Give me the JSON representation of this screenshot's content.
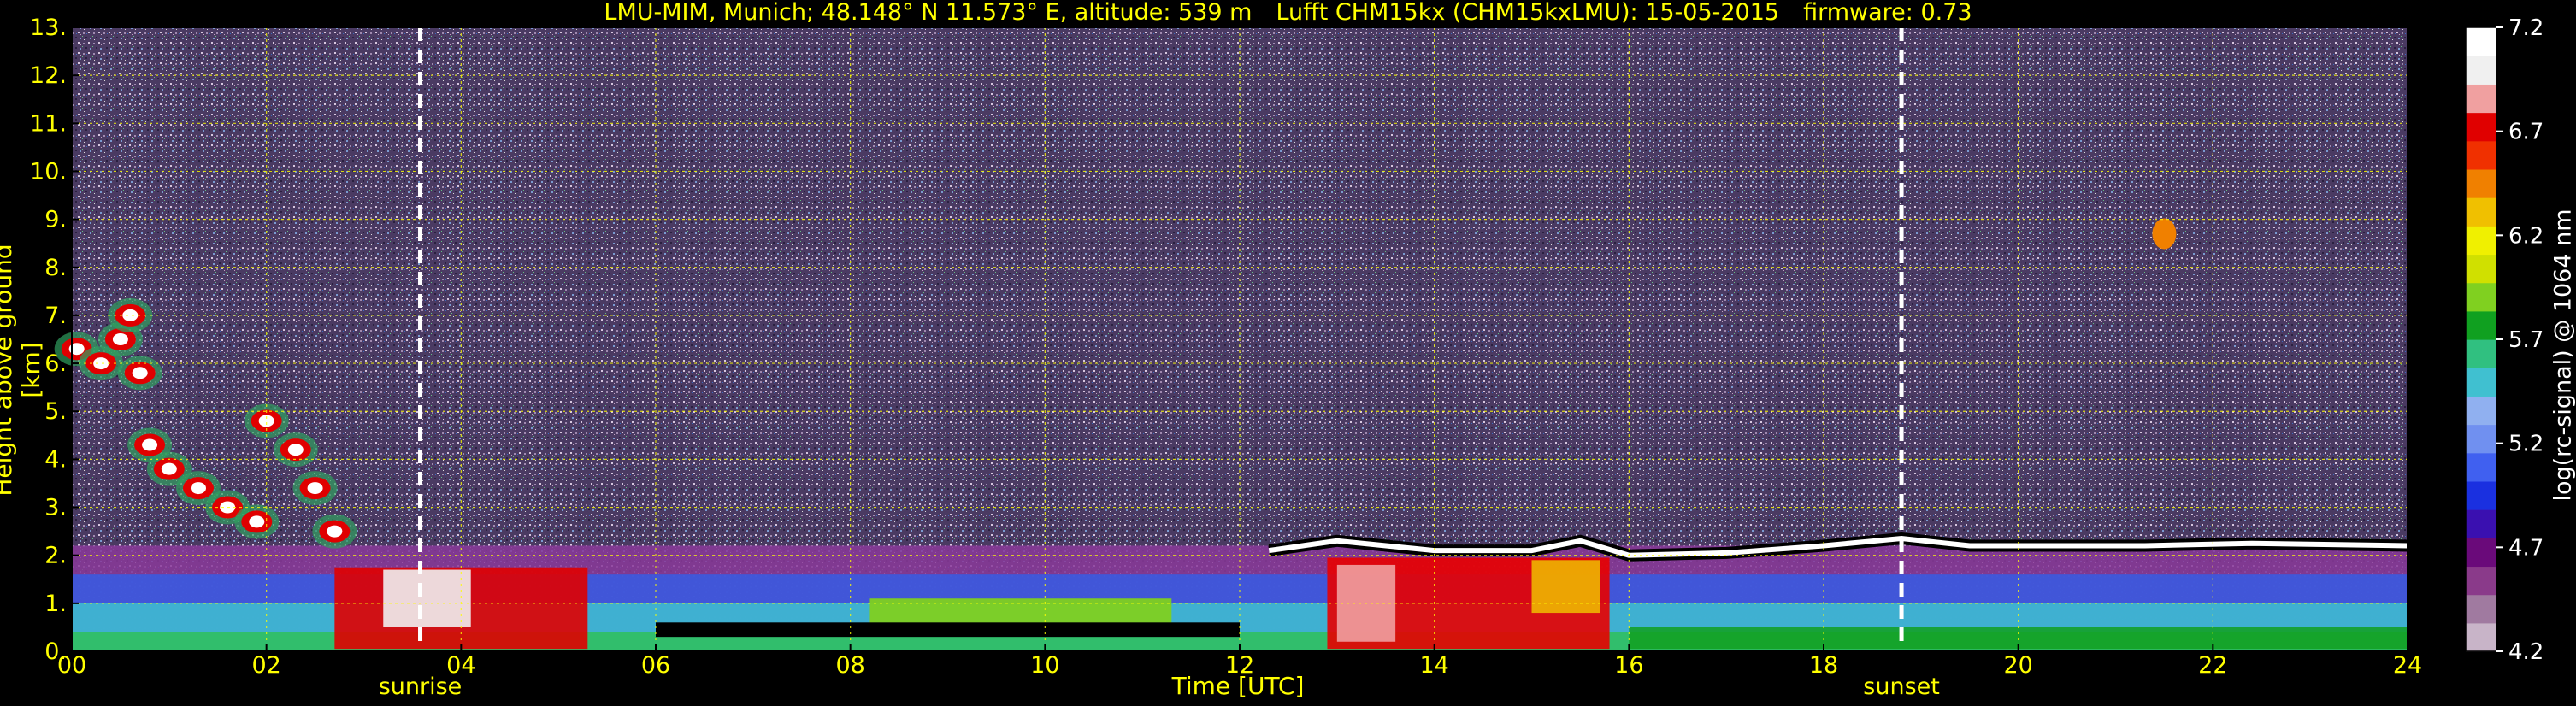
{
  "chart_data": {
    "type": "heatmap",
    "title": {
      "site": "LMU-MIM, Munich; 48.148° N 11.573° E, altitude: 539 m",
      "instrument": "Lufft CHM15kx (CHM15kxLMU): 15-05-2015",
      "firmware": "firmware: 0.73"
    },
    "xlabel": "Time [UTC]",
    "ylabel": "Height above ground [km]",
    "colorbar_label": "log(rc-signal) @ 1064 nm",
    "xlim": [
      0,
      24
    ],
    "ylim": [
      0,
      13
    ],
    "x_ticks": [
      "00",
      "02",
      "04",
      "06",
      "08",
      "10",
      "12",
      "14",
      "16",
      "18",
      "20",
      "22",
      "24"
    ],
    "x_tick_values": [
      0,
      2,
      4,
      6,
      8,
      10,
      12,
      14,
      16,
      18,
      20,
      22,
      24
    ],
    "y_ticks": [
      "0.",
      "1.",
      "2.",
      "3.",
      "4.",
      "5.",
      "6.",
      "7.",
      "8.",
      "9.",
      "10.",
      "11.",
      "12.",
      "13."
    ],
    "y_tick_values": [
      0,
      1,
      2,
      3,
      4,
      5,
      6,
      7,
      8,
      9,
      10,
      11,
      12,
      13
    ],
    "colorbar_range": [
      4.2,
      7.2
    ],
    "colorbar_ticks": [
      "4.2",
      "4.7",
      "5.2",
      "5.7",
      "6.2",
      "6.7",
      "7.2"
    ],
    "colorbar_tick_values": [
      4.2,
      4.7,
      5.2,
      5.7,
      6.2,
      6.7,
      7.2
    ],
    "colormap": [
      "#c8b4c8",
      "#a07aa0",
      "#8a3a8a",
      "#6a0a7a",
      "#3a10b0",
      "#1a30e0",
      "#4060f0",
      "#7090f0",
      "#90b0f0",
      "#40c0d0",
      "#30c080",
      "#10a020",
      "#80d020",
      "#d0e000",
      "#f0f000",
      "#f0c000",
      "#f08000",
      "#f03000",
      "#e00000",
      "#f0a0a0",
      "#f0f0f0",
      "#ffffff"
    ],
    "annotations": [
      {
        "label": "sunrise",
        "x": 3.58
      },
      {
        "label": "sunset",
        "x": 18.8
      }
    ],
    "grid": true,
    "grid_color": "#ffff00",
    "features": {
      "high_cloud": [
        {
          "x": 0.05,
          "y": 6.3
        },
        {
          "x": 0.3,
          "y": 6.0
        },
        {
          "x": 0.5,
          "y": 6.5
        },
        {
          "x": 0.6,
          "y": 7.0
        },
        {
          "x": 0.7,
          "y": 5.8
        },
        {
          "x": 0.8,
          "y": 4.3
        },
        {
          "x": 1.0,
          "y": 3.8
        },
        {
          "x": 1.3,
          "y": 3.4
        },
        {
          "x": 1.6,
          "y": 3.0
        },
        {
          "x": 1.9,
          "y": 2.7
        },
        {
          "x": 2.0,
          "y": 4.8
        },
        {
          "x": 2.3,
          "y": 4.2
        },
        {
          "x": 2.5,
          "y": 3.4
        },
        {
          "x": 2.7,
          "y": 2.5
        }
      ],
      "boundary_layer_top": [
        {
          "x": 12.3,
          "y": 2.1
        },
        {
          "x": 13.0,
          "y": 2.3
        },
        {
          "x": 14.0,
          "y": 2.1
        },
        {
          "x": 15.0,
          "y": 2.1
        },
        {
          "x": 15.5,
          "y": 2.3
        },
        {
          "x": 16.0,
          "y": 2.0
        },
        {
          "x": 17.0,
          "y": 2.05
        },
        {
          "x": 18.0,
          "y": 2.2
        },
        {
          "x": 18.8,
          "y": 2.35
        },
        {
          "x": 19.5,
          "y": 2.2
        },
        {
          "x": 20.5,
          "y": 2.2
        },
        {
          "x": 21.3,
          "y": 2.2
        },
        {
          "x": 22.4,
          "y": 2.25
        },
        {
          "x": 24.0,
          "y": 2.2
        }
      ],
      "small_cloud": {
        "x": 21.5,
        "y": 8.7
      }
    }
  }
}
